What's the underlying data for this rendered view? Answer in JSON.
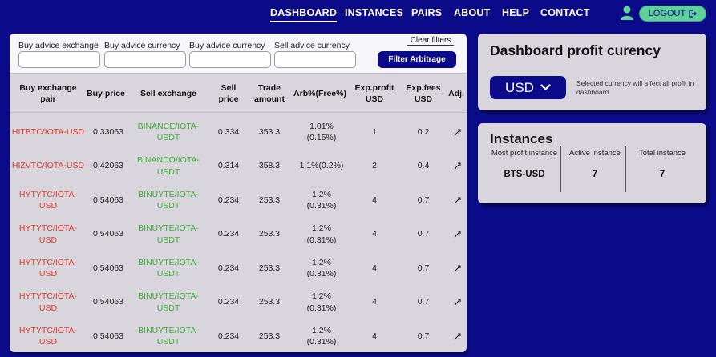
{
  "nav": {
    "links": [
      "DASHBOARD",
      "INSTANCES",
      "PAIRS",
      "ABOUT",
      "HELP",
      "CONTACT"
    ],
    "logout_label": "LOGOUT"
  },
  "filters": {
    "labels": [
      "Buy advice exchange",
      "Buy advice currency",
      "Buy advice currency",
      "Sell advice currency"
    ],
    "clear_label": "Clear filters",
    "filter_button": "Filter Arbitrage"
  },
  "table": {
    "headers": [
      "Buy exchange pair",
      "Buy price",
      "Sell exchange",
      "Sell price",
      "Trade amount",
      "Arb%(Free%)",
      "Exp.profit USD",
      "Exp.fees USD",
      "Adj."
    ],
    "rows": [
      {
        "buy_pair": "HITBTC/IOTA-USD",
        "buy_price": "0.33063",
        "sell_exchange": "BINANCE/IOTA-USDT",
        "sell_price": "0.334",
        "trade_amount": "353.3",
        "arb": "1.01% (0.15%)",
        "profit": "1",
        "fees": "0.2"
      },
      {
        "buy_pair": "HIZVTC/IOTA-USD",
        "buy_price": "0.42063",
        "sell_exchange": "BINANDO/IOTA-USDT",
        "sell_price": "0.314",
        "trade_amount": "358.3",
        "arb": "1.1%(0.2%)",
        "profit": "2",
        "fees": "0.4"
      },
      {
        "buy_pair": "HYTYTC/IOTA-USD",
        "buy_price": "0.54063",
        "sell_exchange": "BINUYTE/IOTA-USDT",
        "sell_price": "0.234",
        "trade_amount": "253.3",
        "arb": "1.2% (0.31%)",
        "profit": "4",
        "fees": "0.7"
      },
      {
        "buy_pair": "HYTYTC/IOTA-USD",
        "buy_price": "0.54063",
        "sell_exchange": "BINUYTE/IOTA-USDT",
        "sell_price": "0.234",
        "trade_amount": "253.3",
        "arb": "1.2% (0.31%)",
        "profit": "4",
        "fees": "0.7"
      },
      {
        "buy_pair": "HYTYTC/IOTA-USD",
        "buy_price": "0.54063",
        "sell_exchange": "BINUYTE/IOTA-USDT",
        "sell_price": "0.234",
        "trade_amount": "253.3",
        "arb": "1.2% (0.31%)",
        "profit": "4",
        "fees": "0.7"
      },
      {
        "buy_pair": "HYTYTC/IOTA-USD",
        "buy_price": "0.54063",
        "sell_exchange": "BINUYTE/IOTA-USDT",
        "sell_price": "0.234",
        "trade_amount": "253.3",
        "arb": "1.2% (0.31%)",
        "profit": "4",
        "fees": "0.7"
      },
      {
        "buy_pair": "HYTYTC/IOTA-USD",
        "buy_price": "0.54063",
        "sell_exchange": "BINUYTE/IOTA-USDT",
        "sell_price": "0.234",
        "trade_amount": "253.3",
        "arb": "1.2% (0.31%)",
        "profit": "4",
        "fees": "0.7"
      }
    ]
  },
  "profit_card": {
    "title": "Dashboard profit curency",
    "currency": "USD",
    "note": "Selected currency will affect all profit in dashboard"
  },
  "instances_card": {
    "title": "Instances",
    "most_profit_label": "Most profit instance",
    "most_profit_value": "BTS-USD",
    "active_label": "Active instance",
    "active_value": "7",
    "total_label": "Total instance",
    "total_value": "7"
  },
  "colors": {
    "background": "#0b0b8a",
    "accent_green": "#5fd09a",
    "buy_red": "#e03a2a",
    "sell_green": "#3fae3a"
  },
  "icons": [
    "user-icon",
    "logout-icon",
    "chevron-down-icon",
    "adjust-icon"
  ]
}
